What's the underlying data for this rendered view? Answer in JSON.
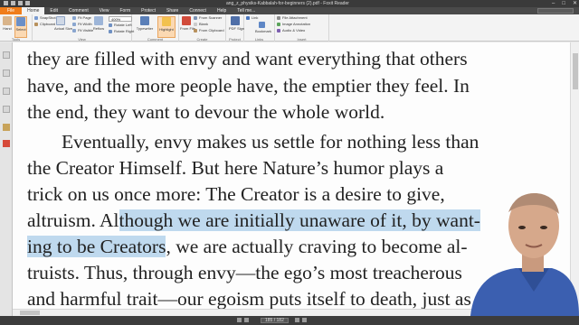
{
  "window": {
    "title": "ang_z_physiks-Kabbalah-for-beginners (2).pdf - Foxit Reader"
  },
  "menu": {
    "tabs": [
      "File",
      "Home",
      "Edit",
      "Comment",
      "View",
      "Form",
      "Protect",
      "Share",
      "Connect",
      "Help",
      "Tell me..."
    ]
  },
  "ribbon": {
    "hand": "Hand",
    "select": "Select",
    "snapshot": "SnapShot",
    "clipboard": "Clipboard",
    "actual_size": "Actual Size",
    "fit_page": "Fit Page",
    "fit_width": "Fit Width",
    "fit_visible": "Fit Visible",
    "reflow": "Reflow",
    "zoom_value": "400%",
    "rotate_left": "Rotate Left",
    "rotate_right": "Rotate Right",
    "typewriter": "Typewriter",
    "highlight": "Highlight",
    "from_file": "From File",
    "from_scanner": "From Scanner",
    "blank": "Blank",
    "from_clipboard": "From Clipboard",
    "pdf_sign": "PDF Sign",
    "link": "Link",
    "bookmark": "Bookmark",
    "file_attachment": "File Attachment",
    "image_annotation": "Image Annotation",
    "audio_video": "Audio & Video",
    "groups": [
      "Tools",
      "View",
      "Comment",
      "Create",
      "Protect",
      "Links",
      "Insert"
    ]
  },
  "document": {
    "lines": [
      {
        "pre": "they are filled with envy and want everything that others",
        "hl": "",
        "post": ""
      },
      {
        "pre": "have, and the more people have, the emptier they feel. In",
        "hl": "",
        "post": ""
      },
      {
        "pre": "the end, they want to devour the whole world.",
        "hl": "",
        "post": ""
      },
      {
        "pre": "Eventually, envy makes us settle for nothing less than",
        "hl": "",
        "post": ""
      },
      {
        "pre": "the Creator Himself. But here Nature’s humor plays a",
        "hl": "",
        "post": ""
      },
      {
        "pre": "trick on us once more: The Creator is a desire to give,",
        "hl": "",
        "post": ""
      },
      {
        "pre": "altruism. Al",
        "hl": "though we are initially unaware of it, by want-",
        "post": ""
      },
      {
        "pre": "",
        "hl": "ing to be Creators",
        "post": ", we are actually craving to become al-"
      },
      {
        "pre": "truists. Thus, through envy—the ego’s most treacherous",
        "hl": "",
        "post": ""
      },
      {
        "pre": "and harmful trait—our egoism puts itself to death, just as",
        "hl": "",
        "post": ""
      }
    ]
  },
  "status": {
    "page_indicator": "185 / 182"
  },
  "colors": {
    "accent": "#f07d1a",
    "highlight": "#bfd9ee"
  }
}
